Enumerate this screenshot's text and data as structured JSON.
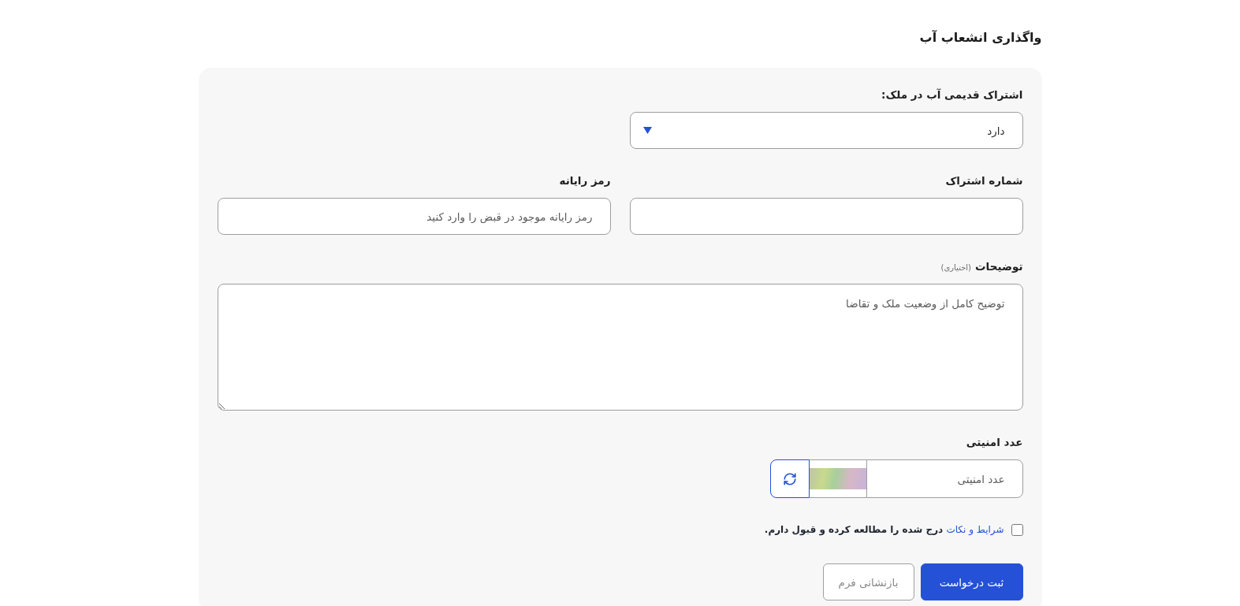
{
  "page": {
    "title": "واگذاری انشعاب آب"
  },
  "old_subscription": {
    "label": "اشتراک قدیمی آب در ملک:",
    "value": "دارد"
  },
  "subscription_number": {
    "label": "شماره اشتراک"
  },
  "computer_code": {
    "label": "رمز رایانه",
    "placeholder": "رمز رایانه موجود در قبض را وارد کنید"
  },
  "description": {
    "label": "توضیحات",
    "hint": "(اختیاری)",
    "placeholder": "توضیح کامل از وضعیت ملک و تقاضا"
  },
  "security_code": {
    "label": "عدد امنیتی",
    "placeholder": "عدد امنیتی"
  },
  "terms": {
    "checked": false,
    "link": "شرایط و نکات",
    "text": "درج شده را مطالعه کرده و قبول دارم."
  },
  "buttons": [
    {
      "kind": "primary",
      "label": "ثبت درخواست"
    },
    {
      "kind": "secondary",
      "label": "بازنشانی فرم"
    }
  ]
}
